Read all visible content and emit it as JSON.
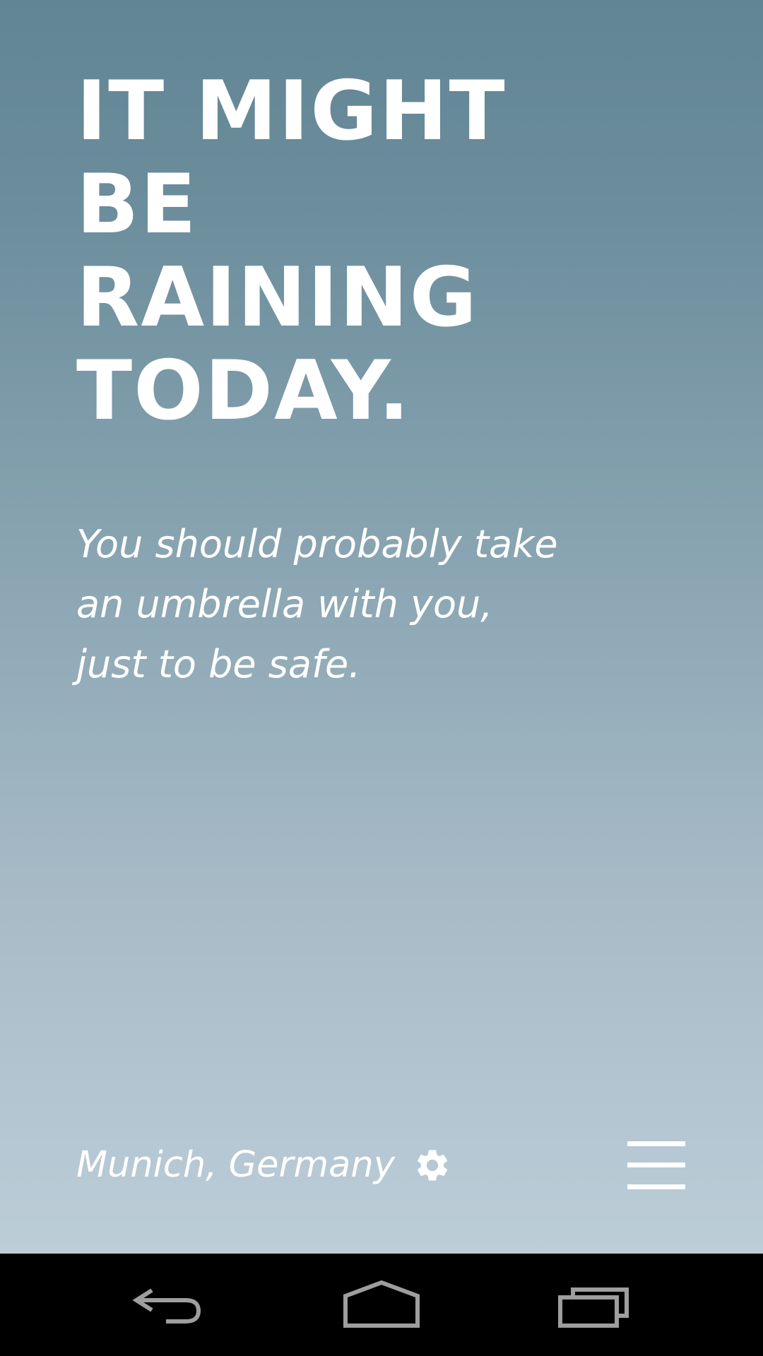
{
  "headline": {
    "lines": [
      "IT MIGHT",
      "BE",
      "RAINING",
      "TODAY."
    ]
  },
  "message": {
    "lines": [
      "You should probably take",
      "an umbrella with you,",
      "just to be safe."
    ]
  },
  "footer": {
    "location": "Munich, Germany",
    "settings_icon": "gear-icon",
    "menu_icon": "hamburger-menu-icon"
  },
  "navbar": {
    "buttons": [
      "back-icon",
      "home-icon",
      "recent-apps-icon"
    ]
  },
  "colors": {
    "gradient_top": "#628594",
    "gradient_bottom": "#bccdd8",
    "text": "#ffffff",
    "navbar_bg": "#000000",
    "navbar_icon": "#9e9e9e"
  }
}
